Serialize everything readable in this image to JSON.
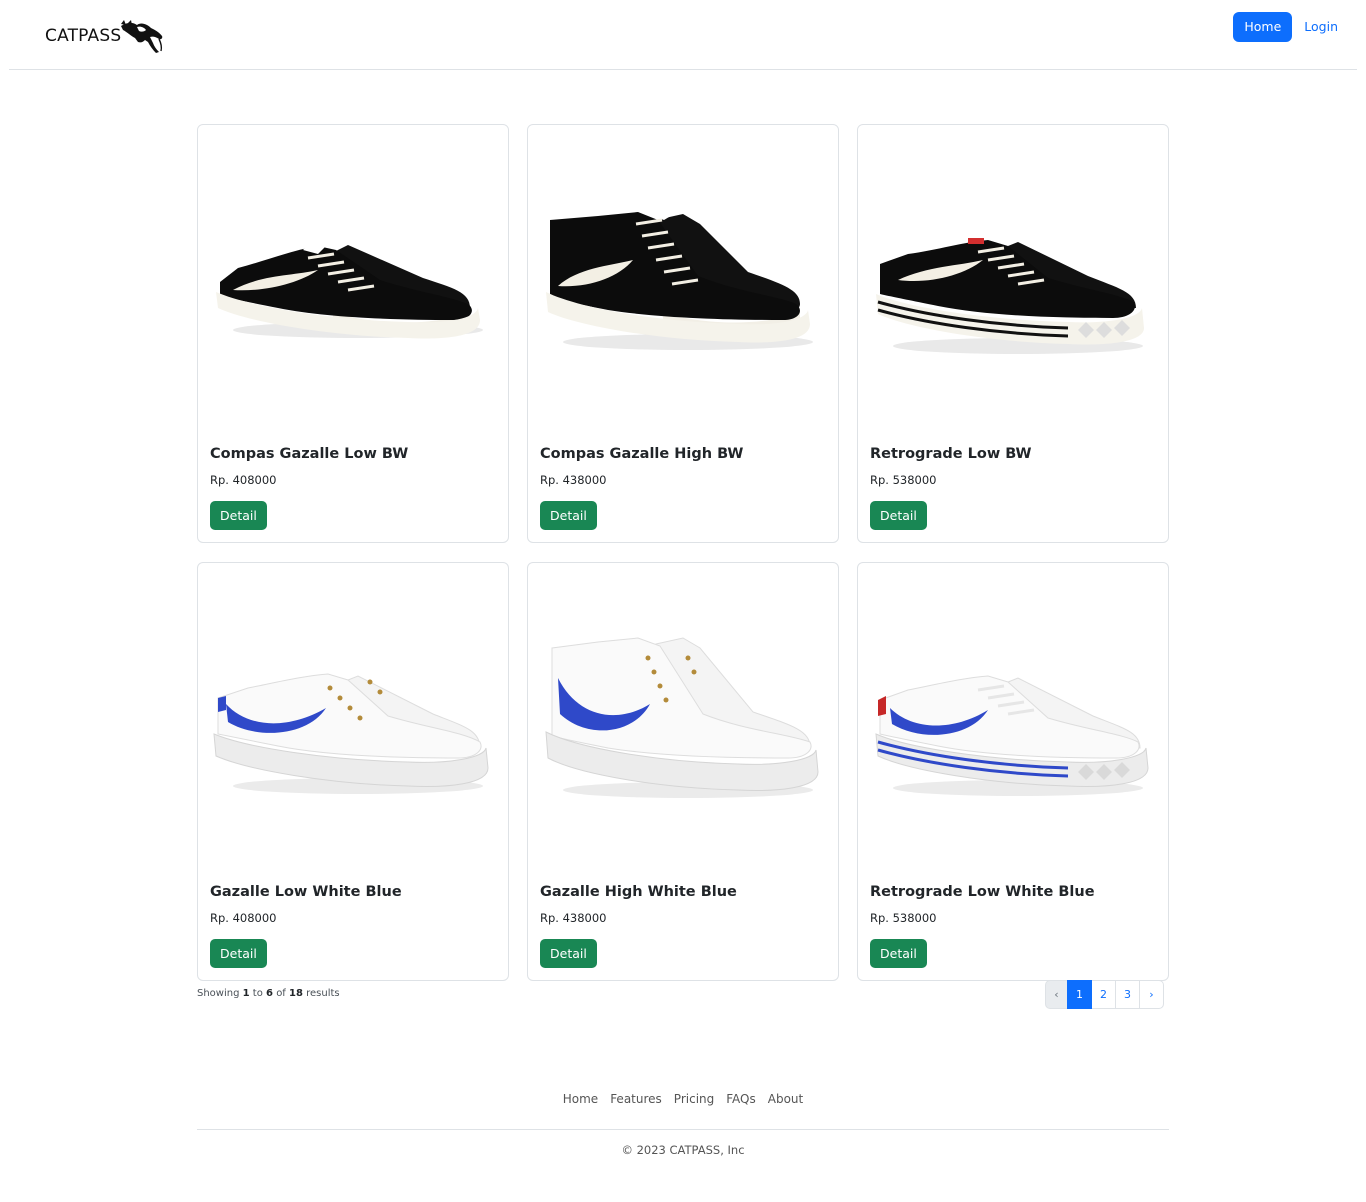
{
  "brand": {
    "name": "CATPASS"
  },
  "nav": {
    "items": [
      {
        "label": "Home",
        "active": true
      },
      {
        "label": "Login",
        "active": false
      }
    ]
  },
  "colors": {
    "primary": "#0d6efd",
    "success": "#198754",
    "border": "#dee2e6"
  },
  "products": [
    {
      "name": "Compas Gazalle Low BW",
      "price": "Rp. 408000",
      "button": "Detail",
      "image": "black-low-sneaker"
    },
    {
      "name": "Compas Gazalle High BW",
      "price": "Rp. 438000",
      "button": "Detail",
      "image": "black-high-sneaker"
    },
    {
      "name": "Retrograde Low BW",
      "price": "Rp. 538000",
      "button": "Detail",
      "image": "black-striped-low-sneaker"
    },
    {
      "name": "Gazalle Low White Blue",
      "price": "Rp. 408000",
      "button": "Detail",
      "image": "white-blue-low-sneaker"
    },
    {
      "name": "Gazalle High White Blue",
      "price": "Rp. 438000",
      "button": "Detail",
      "image": "white-blue-high-sneaker"
    },
    {
      "name": "Retrograde Low White Blue",
      "price": "Rp. 538000",
      "button": "Detail",
      "image": "white-blue-striped-low-sneaker"
    }
  ],
  "results": {
    "prefix": "Showing",
    "from": "1",
    "to_word": "to",
    "to": "6",
    "of_word": "of",
    "total": "18",
    "suffix": "results"
  },
  "pagination": {
    "prev": "‹",
    "pages": [
      "1",
      "2",
      "3"
    ],
    "current": "1",
    "next": "›"
  },
  "footer": {
    "links": [
      "Home",
      "Features",
      "Pricing",
      "FAQs",
      "About"
    ],
    "copyright": "© 2023 CATPASS, Inc"
  }
}
